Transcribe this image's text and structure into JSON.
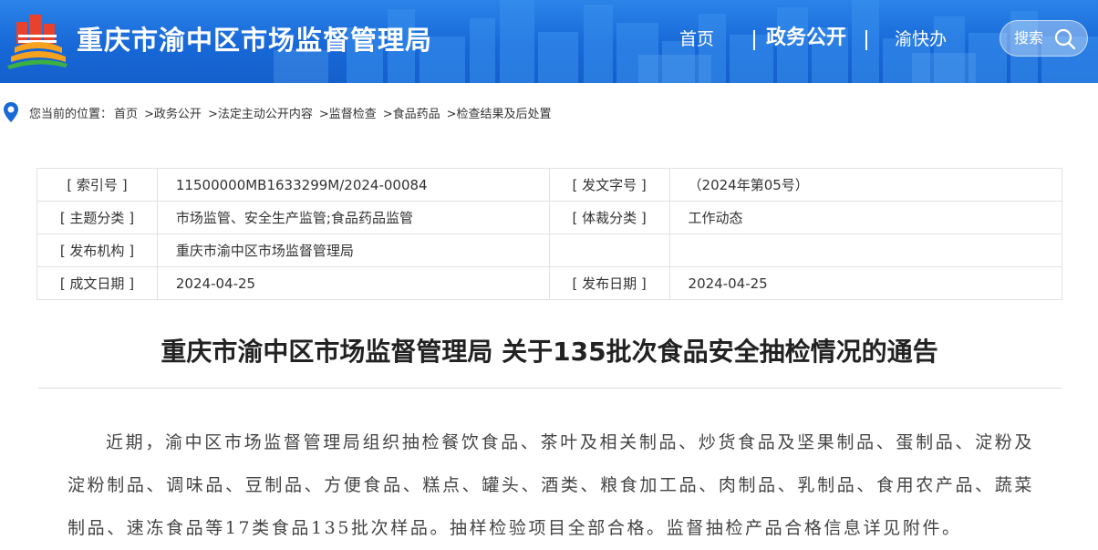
{
  "header": {
    "site_title": "重庆市渝中区市场监督管理局",
    "nav": [
      {
        "label": "首页"
      },
      {
        "label": "政务公开",
        "active": true
      },
      {
        "label": "渝快办"
      }
    ],
    "search_label": "搜索",
    "colors": {
      "header_blue": "#1868d8",
      "logo_red": "#e8412c",
      "logo_orange": "#f6a21e",
      "logo_green": "#3cb043"
    }
  },
  "breadcrumb": {
    "prefix": "您当前的位置：",
    "items": [
      "首页",
      ">政务公开",
      ">法定主动公开内容",
      ">监督检查",
      ">食品药品",
      ">检查结果及后处置"
    ]
  },
  "info": {
    "rows": [
      {
        "l_label": "[ 索引号 ]",
        "l_value": "11500000MB1633299M/2024-00084",
        "r_label": "[ 发文字号 ]",
        "r_value": "（2024年第05号）"
      },
      {
        "l_label": "[ 主题分类 ]",
        "l_value": "市场监管、安全生产监管;食品药品监管",
        "r_label": "[ 体裁分类 ]",
        "r_value": "工作动态"
      },
      {
        "l_label": "[ 发布机构 ]",
        "l_value": "重庆市渝中区市场监督管理局",
        "r_label": "",
        "r_value": ""
      },
      {
        "l_label": "[ 成文日期 ]",
        "l_value": "2024-04-25",
        "r_label": "[ 发布日期 ]",
        "r_value": "2024-04-25"
      }
    ]
  },
  "article": {
    "title": "重庆市渝中区市场监督管理局 关于135批次食品安全抽检情况的通告",
    "body": "近期，渝中区市场监督管理局组织抽检餐饮食品、茶叶及相关制品、炒货食品及坚果制品、蛋制品、淀粉及淀粉制品、调味品、豆制品、方便食品、糕点、罐头、酒类、粮食加工品、肉制品、乳制品、食用农产品、蔬菜制品、速冻食品等17类食品135批次样品。抽样检验项目全部合格。监督抽检产品合格信息详见附件。"
  },
  "icons": {
    "logo": "district-logo-icon",
    "search": "search-icon",
    "location": "location-pin-icon"
  }
}
